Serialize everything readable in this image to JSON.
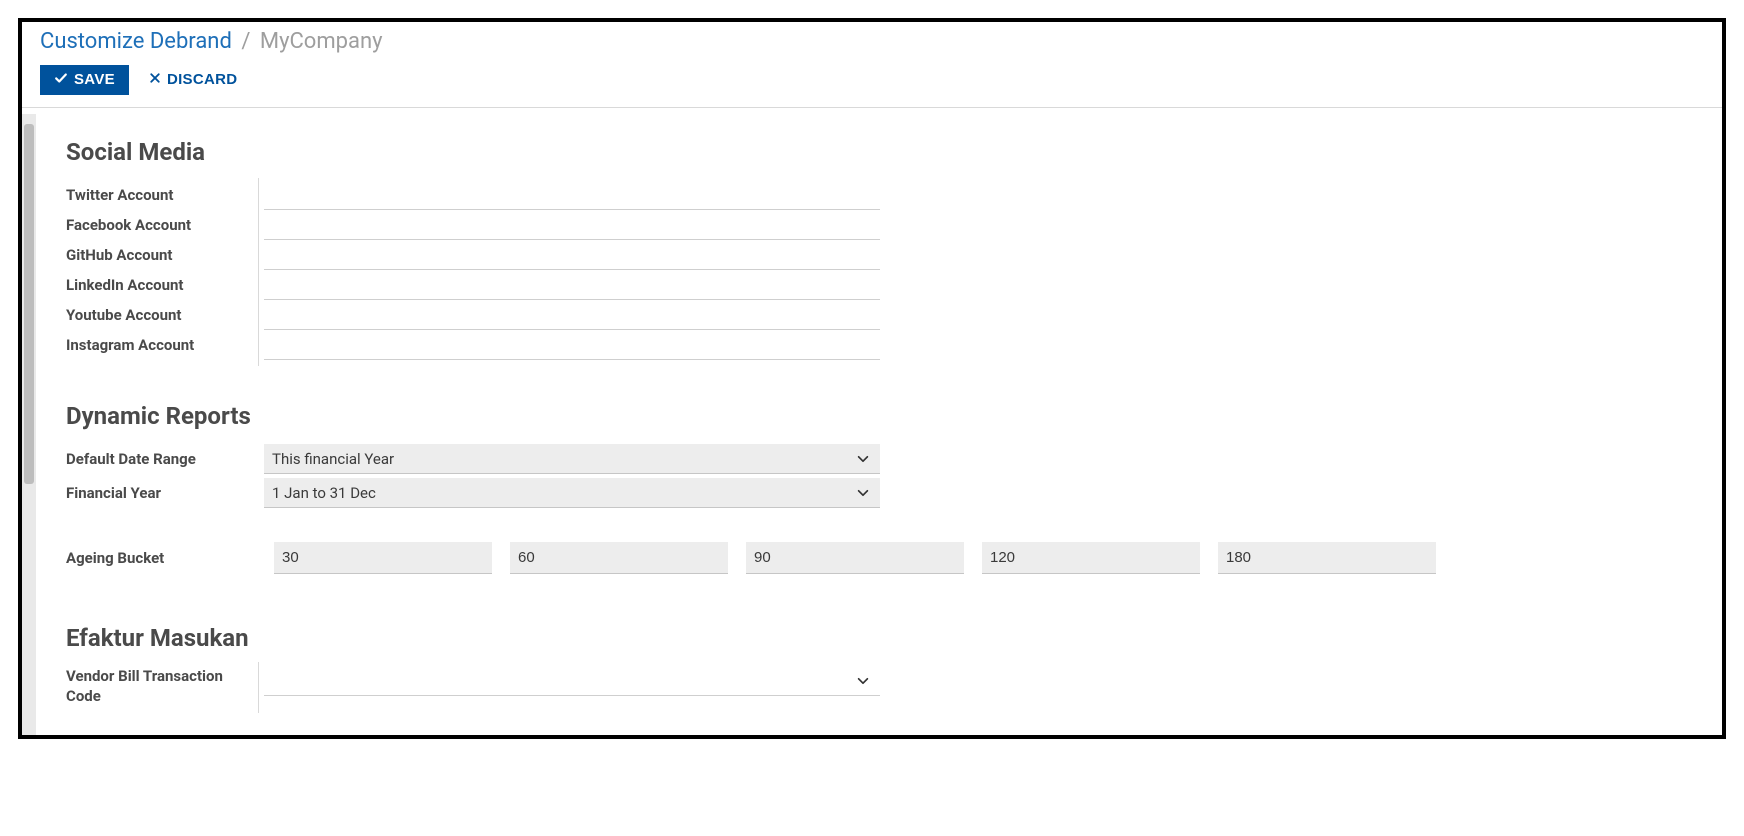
{
  "breadcrumb": {
    "link": "Customize Debrand",
    "current": "MyCompany"
  },
  "actions": {
    "save": "SAVE",
    "discard": "DISCARD"
  },
  "social_media": {
    "title": "Social Media",
    "fields": {
      "twitter": {
        "label": "Twitter Account",
        "value": ""
      },
      "facebook": {
        "label": "Facebook Account",
        "value": ""
      },
      "github": {
        "label": "GitHub Account",
        "value": ""
      },
      "linkedin": {
        "label": "LinkedIn Account",
        "value": ""
      },
      "youtube": {
        "label": "Youtube Account",
        "value": ""
      },
      "instagram": {
        "label": "Instagram Account",
        "value": ""
      }
    }
  },
  "dynamic_reports": {
    "title": "Dynamic Reports",
    "default_date_range": {
      "label": "Default Date Range",
      "value": "This financial Year"
    },
    "financial_year": {
      "label": "Financial Year",
      "value": "1 Jan to 31 Dec"
    },
    "ageing_bucket": {
      "label": "Ageing Bucket",
      "values": [
        "30",
        "60",
        "90",
        "120",
        "180"
      ]
    }
  },
  "efaktur": {
    "title": "Efaktur Masukan",
    "vendor_bill_tx": {
      "label": "Vendor Bill Transaction Code",
      "value": ""
    }
  }
}
